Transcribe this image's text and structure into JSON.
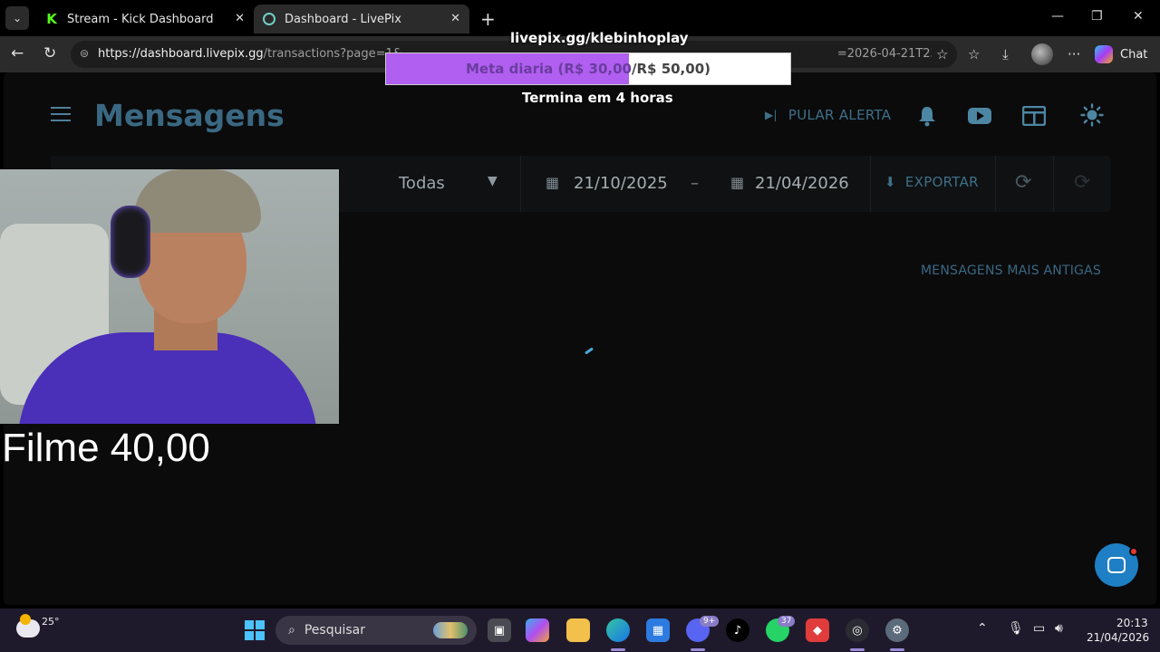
{
  "browser": {
    "tabs": [
      {
        "title": "Stream - Kick Dashboard",
        "active": false
      },
      {
        "title": "Dashboard - LivePix",
        "active": true
      }
    ],
    "url_host": "https://dashboard.livepix.gg",
    "url_path": "/transactions?page=1&",
    "url_tail": "=2026-04-21T23%3A59%3A59-03...",
    "chat_label": "Chat"
  },
  "page": {
    "title": "Mensagens",
    "skip_alert": "PULAR ALERTA",
    "filter_type": "Todas",
    "date_from": "21/10/2025",
    "date_separator": "–",
    "date_to": "21/04/2026",
    "export_label": "EXPORTAR",
    "older_messages": "MENSAGENS MAIS ANTIGAS"
  },
  "overlay": {
    "goal_url": "livepix.gg/klebinhoplay",
    "goal_current": "Meta diaria (R$ 30,00",
    "goal_total": "/R$ 50,00)",
    "goal_progress": 0.6,
    "goal_ends": "Termina em 4 horas",
    "film_text": "Filme 40,00"
  },
  "taskbar": {
    "temperature": "25°",
    "search_placeholder": "Pesquisar",
    "discord_badge": "9+",
    "whatsapp_badge": "37",
    "time": "20:13",
    "date": "21/04/2026"
  },
  "colors": {
    "accent": "#3a6882",
    "goal_fill": "#b05ff0",
    "intercom": "#1e7fc4"
  }
}
